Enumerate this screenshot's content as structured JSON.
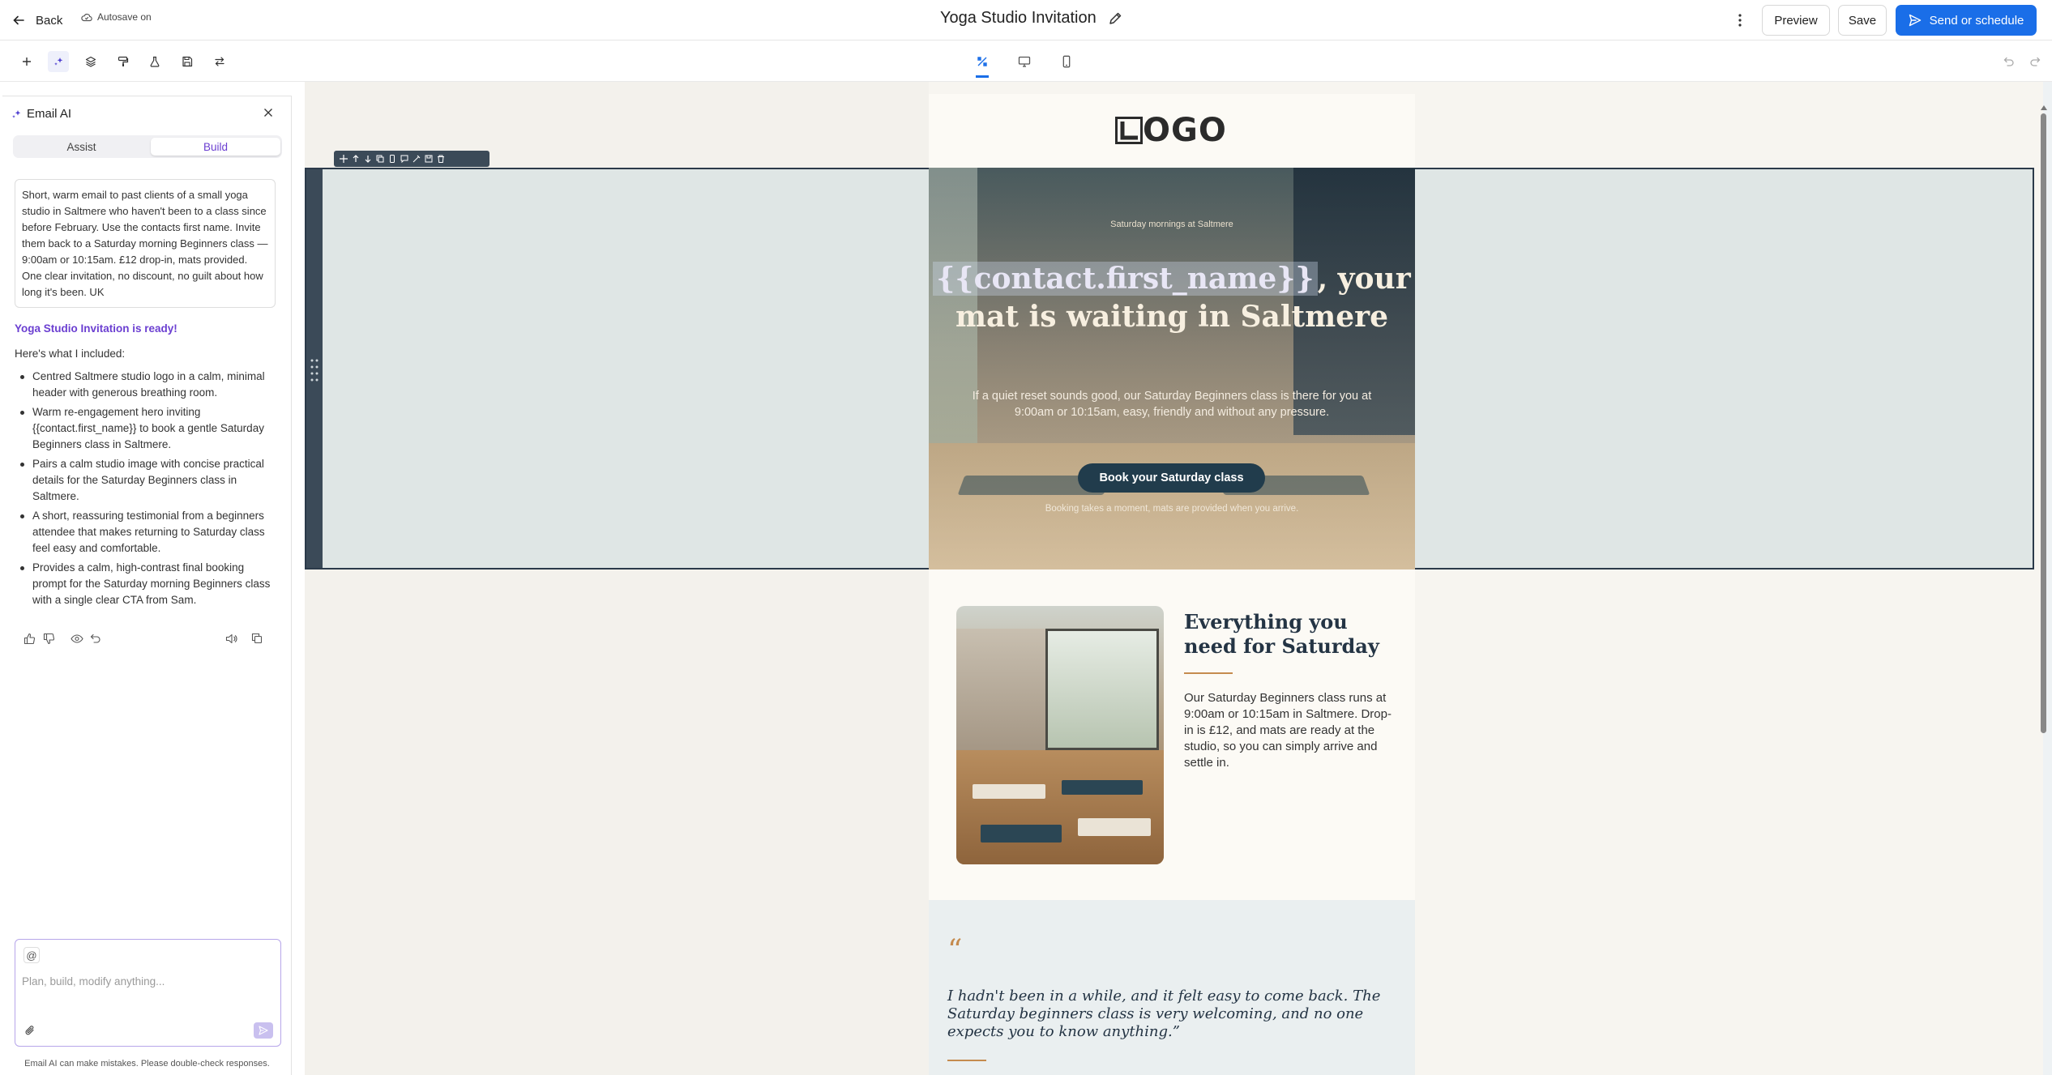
{
  "topbar": {
    "back_label": "Back",
    "autosave_label": "Autosave on",
    "title": "Yoga Studio Invitation",
    "preview_label": "Preview",
    "save_label": "Save",
    "send_label": "Send or schedule"
  },
  "panel": {
    "title": "Email AI",
    "tabs": [
      {
        "label": "Assist"
      },
      {
        "label": "Build"
      }
    ],
    "active_tab": "Build",
    "prompt_text": "Short, warm email to past clients of a small yoga studio in Saltmere who haven't been to a class since before February. Use the contacts first name. Invite them back to a Saturday morning Beginners class — 9:00am or 10:15am. £12 drop-in, mats provided. One clear invitation, no discount, no guilt about how long it's been. UK",
    "ready_text": "Yoga Studio Invitation is ready!",
    "included_intro": "Here's what I included:",
    "bullets": [
      "Centred Saltmere studio logo in a calm, minimal header with generous breathing room.",
      "Warm re-engagement hero inviting {{contact.first_name}} to book a gentle Saturday Beginners class in Saltmere.",
      "Pairs a calm studio image with concise practical details for the Saturday Beginners class in Saltmere.",
      "A short, reassuring testimonial from a beginners attendee that makes returning to Saturday class feel easy and comfortable.",
      "Provides a calm, high-contrast final booking prompt for the Saturday morning Beginners class with a single clear CTA from Sam."
    ],
    "chat_at": "@",
    "chat_placeholder": "Plan, build, modify anything...",
    "disclaimer": "Email AI can make mistakes. Please double-check responses."
  },
  "email": {
    "logo_text": "OGO",
    "hero": {
      "eyebrow": "Saturday mornings at Saltmere",
      "merge_tag": "{{contact.first_name}}",
      "headline_rest": ", your mat is waiting in Saltmere",
      "body": "If a quiet reset sounds good, our Saturday Beginners class is there for you at 9:00am or 10:15am, easy, friendly and without any pressure.",
      "cta": "Book your Saturday class",
      "footnote": "Booking takes a moment, mats are provided when you arrive."
    },
    "details": {
      "heading": "Everything you need for Saturday",
      "body": "Our Saturday Beginners class runs at 9:00am or 10:15am in Saltmere. Drop-in is £12, and mats are ready at the studio, so you can simply arrive and settle in."
    },
    "testimonial": {
      "quote_mark": "“",
      "quote": "I hadn't been in a while, and it felt easy to come back. The Saturday beginners class is very welcoming, and no one expects you to know anything.”"
    }
  },
  "colors": {
    "accent": "#1a6ee8",
    "ai_purple": "#6b3fd1",
    "cta_dark": "#213c4c",
    "heading_navy": "#243444",
    "rule_copper": "#c58b4e"
  },
  "icons": {
    "toolbar": [
      "plus-icon",
      "sparkle-icon",
      "layers-icon",
      "paint-roller-icon",
      "flask-icon",
      "save-icon",
      "swap-icon"
    ],
    "views": [
      "design-icon",
      "desktop-icon",
      "mobile-icon"
    ]
  }
}
